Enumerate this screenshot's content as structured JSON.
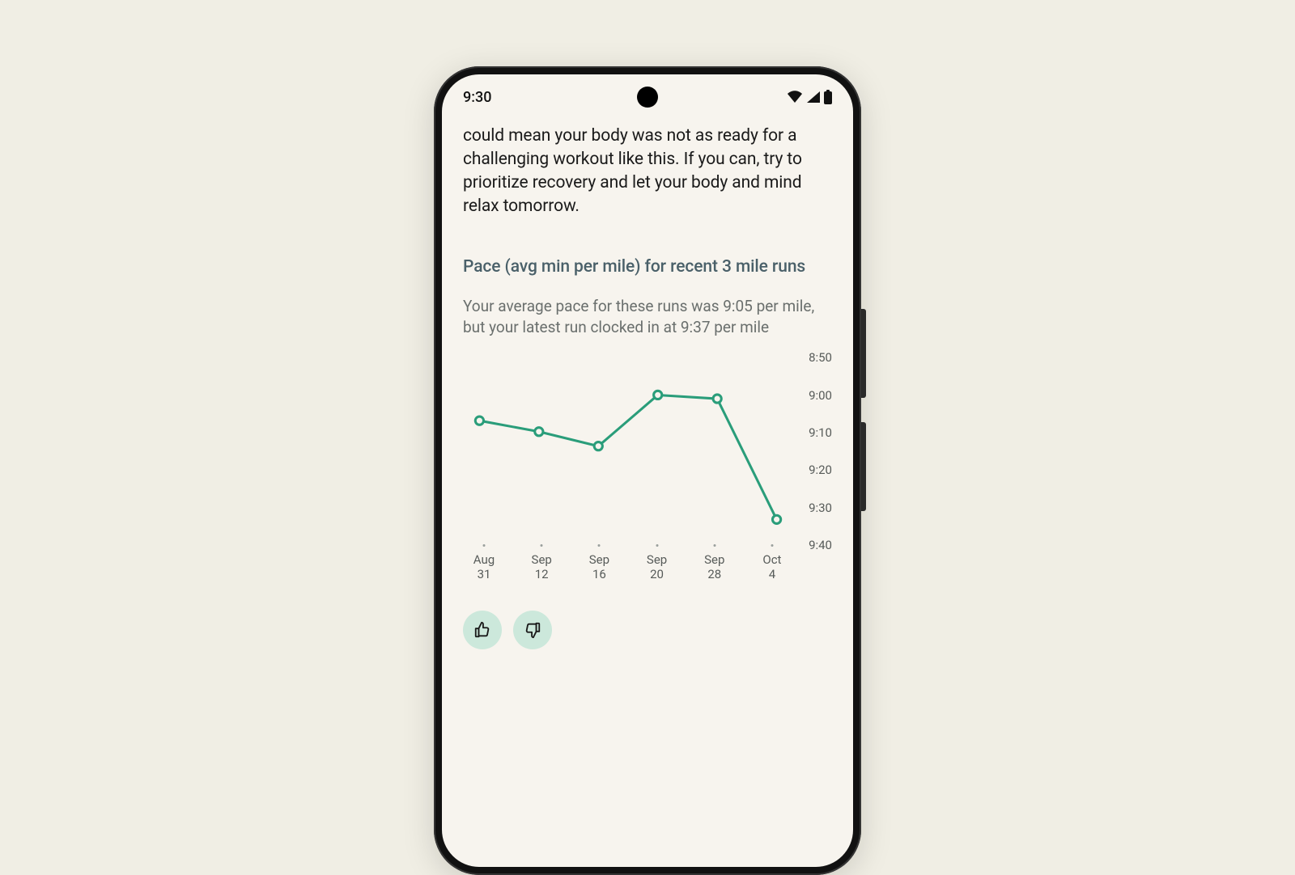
{
  "status": {
    "time": "9:30"
  },
  "content": {
    "body_text": "could mean your body was not as ready for a challenging workout like this. If you can, try to prioritize recovery and let your body and mind relax tomorrow.",
    "section_title": "Pace (avg min per mile) for recent 3 mile runs",
    "section_sub": "Your average pace for these runs was 9:05 per mile, but your latest run clocked in at 9:37 per mile"
  },
  "chart_data": {
    "type": "line",
    "title": "Pace (avg min per mile) for recent 3 mile runs",
    "xlabel": "",
    "ylabel": "",
    "ylim_minutes": [
      8.833,
      9.667
    ],
    "y_tick_labels": [
      "8:50",
      "9:00",
      "9:10",
      "9:20",
      "9:30",
      "9:40"
    ],
    "categories": [
      "Aug\n31",
      "Sep\n12",
      "Sep\n16",
      "Sep\n20",
      "Sep\n28",
      "Oct\n4"
    ],
    "series": [
      {
        "name": "pace_min_per_mile",
        "values_label": [
          "9:07",
          "9:10",
          "9:14",
          "9:00",
          "9:01",
          "9:34"
        ],
        "values_minutes": [
          9.117,
          9.167,
          9.233,
          9.0,
          9.017,
          9.567
        ]
      }
    ],
    "colors": {
      "line": "#2a9d7a",
      "point_fill": "#f7f4ee"
    }
  }
}
